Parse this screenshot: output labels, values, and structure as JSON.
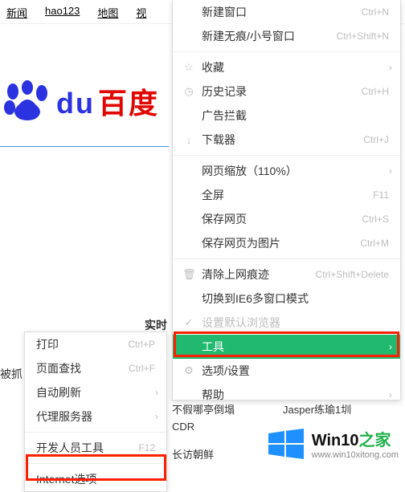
{
  "topnav": {
    "news": "新闻",
    "hao123": "hao123",
    "map": "地图",
    "video": "视"
  },
  "brand": {
    "du": "du",
    "cn": "百度"
  },
  "realtime_label": "实时",
  "caught_label": "被抓",
  "main_menu": {
    "new_window": {
      "label": "新建窗口",
      "sc": "Ctrl+N"
    },
    "new_incognito": {
      "label": "新建无痕/小号窗口",
      "sc": "Ctrl+Shift+N"
    },
    "favorites": {
      "label": "收藏"
    },
    "history": {
      "label": "历史记录",
      "sc": "Ctrl+H"
    },
    "adblock": {
      "label": "广告拦截"
    },
    "downloads": {
      "label": "下载器",
      "sc": "Ctrl+J"
    },
    "zoom": {
      "label": "网页缩放（110%）"
    },
    "fullscreen": {
      "label": "全屏",
      "sc": "F11"
    },
    "save_page": {
      "label": "保存网页",
      "sc": "Ctrl+S"
    },
    "save_image": {
      "label": "保存网页为图片",
      "sc": "Ctrl+M"
    },
    "clear_trace": {
      "label": "清除上网痕迹",
      "sc": "Ctrl+Shift+Delete"
    },
    "switch_ie6": {
      "label": "切换到IE6多窗口模式"
    },
    "set_default": {
      "label": "设置默认浏览器"
    },
    "tools": {
      "label": "工具"
    },
    "options": {
      "label": "选项/设置"
    },
    "help": {
      "label": "帮助"
    }
  },
  "sub_menu": {
    "print": {
      "label": "打印",
      "sc": "Ctrl+P"
    },
    "find": {
      "label": "页面查找",
      "sc": "Ctrl+F"
    },
    "auto_refresh": {
      "label": "自动刷新"
    },
    "proxy": {
      "label": "代理服务器"
    },
    "dev_tools": {
      "label": "开发人员工具",
      "sc": "F12"
    },
    "internet_options": {
      "label": "Internet选项"
    }
  },
  "bg_text": {
    "a": "不假哪亭倒塌",
    "b": "Jasper练瑜1圳",
    "c": "CDR",
    "d": "长访朝鲜"
  },
  "watermark": {
    "brand": "Win10",
    "zhi": "之家",
    "url": "www.win10xitong.com"
  }
}
